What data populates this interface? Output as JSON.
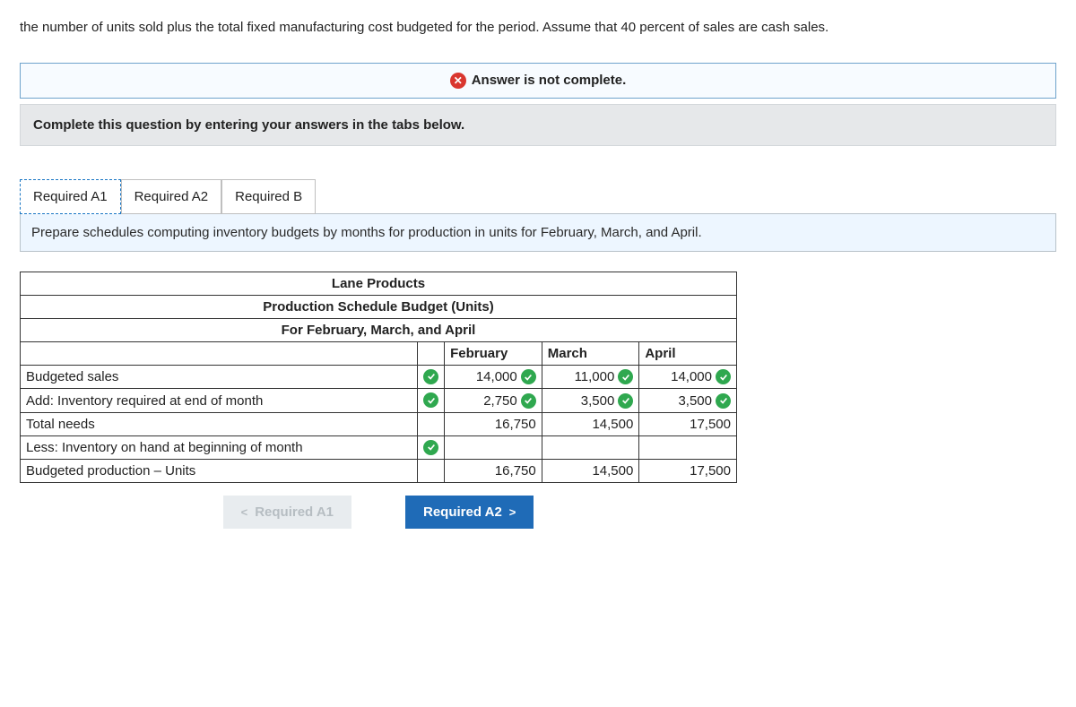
{
  "intro": "the number of units sold plus the total fixed manufacturing cost budgeted for the period. Assume that 40 percent of sales are cash sales.",
  "status_banner": "Answer is not complete.",
  "instruction": "Complete this question by entering your answers in the tabs below.",
  "tabs": {
    "a1": "Required A1",
    "a2": "Required A2",
    "b": "Required B"
  },
  "prompt": "Prepare schedules computing inventory budgets by months for production in units for February, March, and April.",
  "table": {
    "title1": "Lane Products",
    "title2": "Production Schedule Budget (Units)",
    "title3": "For February, March, and April",
    "col_headers": {
      "c1": "February",
      "c2": "March",
      "c3": "April"
    },
    "rows": {
      "budgeted_sales": {
        "label": "Budgeted sales",
        "feb": "14,000",
        "mar": "11,000",
        "apr": "14,000"
      },
      "add_inv_end": {
        "label": "Add: Inventory required at end of month",
        "feb": "2,750",
        "mar": "3,500",
        "apr": "3,500"
      },
      "total_needs": {
        "label": "Total needs",
        "feb": "16,750",
        "mar": "14,500",
        "apr": "17,500"
      },
      "less_inv_begin": {
        "label": "Less: Inventory on hand at beginning of month",
        "feb": "",
        "mar": "",
        "apr": ""
      },
      "budgeted_prod": {
        "label": "Budgeted production – Units",
        "feb": "16,750",
        "mar": "14,500",
        "apr": "17,500"
      }
    }
  },
  "nav": {
    "prev": "Required A1",
    "next": "Required A2"
  },
  "chart_data": {
    "type": "table",
    "title": "Lane Products — Production Schedule Budget (Units) — For February, March, and April",
    "columns": [
      "February",
      "March",
      "April"
    ],
    "rows": [
      {
        "label": "Budgeted sales",
        "values": [
          14000,
          11000,
          14000
        ]
      },
      {
        "label": "Add: Inventory required at end of month",
        "values": [
          2750,
          3500,
          3500
        ]
      },
      {
        "label": "Total needs",
        "values": [
          16750,
          14500,
          17500
        ]
      },
      {
        "label": "Less: Inventory on hand at beginning of month",
        "values": [
          null,
          null,
          null
        ]
      },
      {
        "label": "Budgeted production – Units",
        "values": [
          16750,
          14500,
          17500
        ]
      }
    ]
  }
}
